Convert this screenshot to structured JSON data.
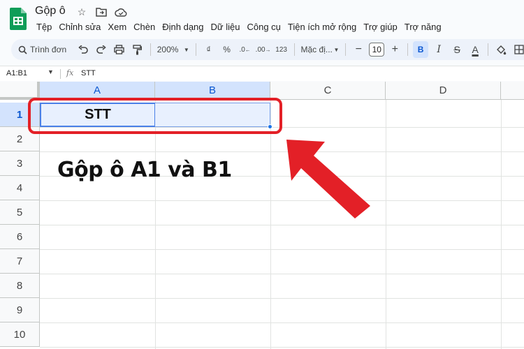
{
  "app": {
    "doc_title": "Gộp ô",
    "menu": [
      "Tệp",
      "Chỉnh sửa",
      "Xem",
      "Chèn",
      "Định dạng",
      "Dữ liệu",
      "Công cụ",
      "Tiện ích mở rộng",
      "Trợ giúp",
      "Trợ năng"
    ]
  },
  "toolbar": {
    "search_label": "Trình đơn",
    "zoom": "200%",
    "currency": "₫",
    "percent": "%",
    "dec_decrease": ".0",
    "dec_increase": ".00",
    "number_format": "123",
    "font": "Mặc đị...",
    "font_size": "10",
    "bold": "B",
    "italic": "I",
    "strike": "S",
    "text_color": "A"
  },
  "formula_bar": {
    "name_box": "A1:B1",
    "fx": "fx",
    "value": "STT"
  },
  "grid": {
    "columns": [
      "A",
      "B",
      "C",
      "D"
    ],
    "rows": [
      "1",
      "2",
      "3",
      "4",
      "5",
      "6",
      "7",
      "8",
      "9",
      "10"
    ],
    "cells": {
      "A1": "STT"
    }
  },
  "annotation": {
    "text": "Gộp ô A1 và B1",
    "color": "#e32027"
  }
}
